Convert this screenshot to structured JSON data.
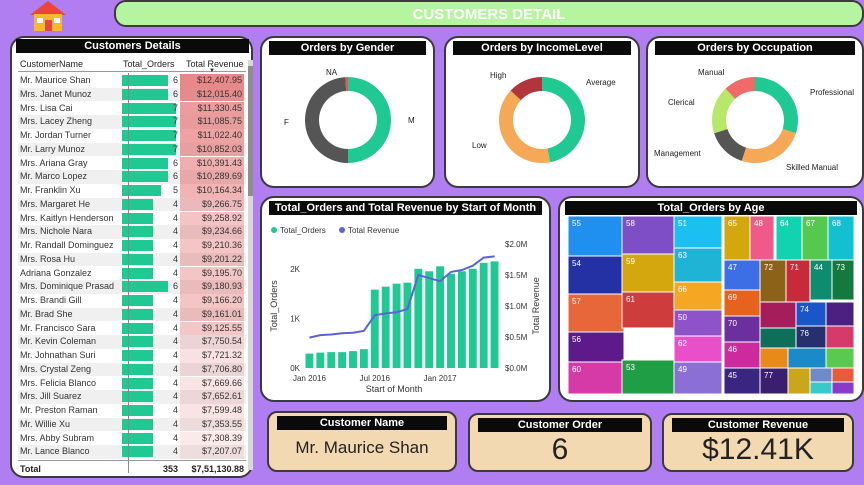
{
  "header": {
    "title": "CUSTOMERS DETAIL"
  },
  "icons": {
    "home": "home-icon"
  },
  "colors": {
    "accent_green": "#1fc991",
    "revenue_red": "#e05a5a",
    "background": "#b07ef0",
    "banner": "#b6f5a0",
    "kpi_bg": "#f3d9b1"
  },
  "table": {
    "title": "Customers Details",
    "columns": [
      "CustomerName",
      "Total_Orders",
      "Total Revenue"
    ],
    "rows": [
      {
        "name": "Mr. Maurice Shan",
        "orders": 6,
        "revenue": "$12,407.95"
      },
      {
        "name": "Mrs. Janet Munoz",
        "orders": 6,
        "revenue": "$12,015.40"
      },
      {
        "name": "Mrs. Lisa Cai",
        "orders": 7,
        "revenue": "$11,330.45"
      },
      {
        "name": "Mrs. Lacey Zheng",
        "orders": 7,
        "revenue": "$11,085.75"
      },
      {
        "name": "Mr. Jordan Turner",
        "orders": 7,
        "revenue": "$11,022.40"
      },
      {
        "name": "Mr. Larry Munoz",
        "orders": 7,
        "revenue": "$10,852.03"
      },
      {
        "name": "Mrs. Ariana Gray",
        "orders": 6,
        "revenue": "$10,391.43"
      },
      {
        "name": "Mr. Marco Lopez",
        "orders": 6,
        "revenue": "$10,289.69"
      },
      {
        "name": "Mr. Franklin Xu",
        "orders": 5,
        "revenue": "$10,164.34"
      },
      {
        "name": "Mrs. Margaret He",
        "orders": 4,
        "revenue": "$9,266.75"
      },
      {
        "name": "Mrs. Kaitlyn Henderson",
        "orders": 4,
        "revenue": "$9,258.92"
      },
      {
        "name": "Mrs. Nichole Nara",
        "orders": 4,
        "revenue": "$9,234.66"
      },
      {
        "name": "Mr. Randall Dominguez",
        "orders": 4,
        "revenue": "$9,210.36"
      },
      {
        "name": "Mrs. Rosa Hu",
        "orders": 4,
        "revenue": "$9,201.22"
      },
      {
        "name": "Adriana Gonzalez",
        "orders": 4,
        "revenue": "$9,195.70"
      },
      {
        "name": "Mrs. Dominique Prasad",
        "orders": 6,
        "revenue": "$9,180.93"
      },
      {
        "name": "Mrs. Brandi Gill",
        "orders": 4,
        "revenue": "$9,166.20"
      },
      {
        "name": "Mr. Brad She",
        "orders": 4,
        "revenue": "$9,161.01"
      },
      {
        "name": "Mr. Francisco Sara",
        "orders": 4,
        "revenue": "$9,125.55"
      },
      {
        "name": "Mr. Kevin Coleman",
        "orders": 4,
        "revenue": "$7,750.54"
      },
      {
        "name": "Mr. Johnathan Suri",
        "orders": 4,
        "revenue": "$7,721.32"
      },
      {
        "name": "Mrs. Crystal Zeng",
        "orders": 4,
        "revenue": "$7,706.80"
      },
      {
        "name": "Mrs. Felicia Blanco",
        "orders": 4,
        "revenue": "$7,669.66"
      },
      {
        "name": "Mrs. Jill Suarez",
        "orders": 4,
        "revenue": "$7,652.61"
      },
      {
        "name": "Mr. Preston Raman",
        "orders": 4,
        "revenue": "$7,599.48"
      },
      {
        "name": "Mr. Willie Xu",
        "orders": 4,
        "revenue": "$7,353.55"
      },
      {
        "name": "Mrs. Abby Subram",
        "orders": 4,
        "revenue": "$7,308.39"
      },
      {
        "name": "Mr. Lance Blanco",
        "orders": 4,
        "revenue": "$7,207.07"
      }
    ],
    "total": {
      "label": "Total",
      "orders": "353",
      "revenue": "$7,51,130.88"
    }
  },
  "chart_data": [
    {
      "type": "pie",
      "donut": true,
      "title": "Orders by Gender",
      "labels": [
        "M",
        "F",
        "NA"
      ],
      "values": [
        50,
        49,
        1
      ],
      "colors": [
        "#1fc991",
        "#555555",
        "#e05a5a"
      ]
    },
    {
      "type": "pie",
      "donut": true,
      "title": "Orders by IncomeLevel",
      "labels": [
        "Average",
        "Low",
        "High"
      ],
      "values": [
        47,
        40,
        13
      ],
      "colors": [
        "#1fc991",
        "#f5a855",
        "#b0353d"
      ]
    },
    {
      "type": "pie",
      "donut": true,
      "title": "Orders by Occupation",
      "labels": [
        "Professional",
        "Skilled Manual",
        "Management",
        "Clerical",
        "Manual"
      ],
      "values": [
        30,
        25,
        15,
        18,
        12
      ],
      "colors": [
        "#1fc991",
        "#f5a855",
        "#555555",
        "#b8e86a",
        "#f06a6a"
      ]
    },
    {
      "type": "bar+line",
      "title": "Total_Orders and Total Revenue by Start of Month",
      "xlabel": "Start of Month",
      "ylabel": "Total_Orders",
      "y2label": "Total Revenue",
      "x_ticks": [
        "Jan 2016",
        "Jul 2016",
        "Jan 2017"
      ],
      "y_ticks": [
        "0K",
        "1K",
        "2K"
      ],
      "y2_ticks": [
        "$0.0M",
        "$0.5M",
        "$1.0M",
        "$1.5M",
        "$2.0M"
      ],
      "ylim": [
        0,
        2500
      ],
      "y2lim": [
        0,
        2000000
      ],
      "legend": [
        "Total_Orders",
        "Total Revenue"
      ],
      "categories": [
        "2016-01",
        "2016-02",
        "2016-03",
        "2016-04",
        "2016-05",
        "2016-06",
        "2016-07",
        "2016-08",
        "2016-09",
        "2016-10",
        "2016-11",
        "2016-12",
        "2017-01",
        "2017-02",
        "2017-03",
        "2017-04",
        "2017-05",
        "2017-06"
      ],
      "series": [
        {
          "name": "Total_Orders",
          "values": [
            290,
            310,
            320,
            320,
            340,
            380,
            1580,
            1640,
            1700,
            1720,
            2000,
            1950,
            2050,
            1900,
            1950,
            2000,
            2120,
            2150
          ]
        },
        {
          "name": "Total Revenue",
          "values": [
            490000,
            530000,
            540000,
            560000,
            570000,
            600000,
            850000,
            880000,
            900000,
            950000,
            1500000,
            1450000,
            1400000,
            1550000,
            1580000,
            1650000,
            1780000,
            1800000
          ]
        }
      ]
    },
    {
      "type": "treemap",
      "title": "Total_Orders by Age",
      "labels": [
        "55",
        "58",
        "51",
        "65",
        "48",
        "64",
        "67",
        "68",
        "54",
        "59",
        "63",
        "47",
        "72",
        "71",
        "44",
        "73",
        "57",
        "61",
        "66",
        "69",
        "74",
        "50",
        "70",
        "56",
        "62",
        "76",
        "60",
        "53",
        "49",
        "46",
        "45",
        "77"
      ],
      "values": [
        90,
        85,
        60,
        40,
        38,
        36,
        34,
        30,
        88,
        80,
        55,
        36,
        30,
        30,
        28,
        28,
        86,
        78,
        50,
        34,
        26,
        48,
        32,
        84,
        46,
        22,
        82,
        60,
        44,
        30,
        30,
        20
      ]
    }
  ],
  "kpis": {
    "name": {
      "label": "Customer Name",
      "value": "Mr. Maurice Shan"
    },
    "orders": {
      "label": "Customer Order",
      "value": "6"
    },
    "revenue": {
      "label": "Customer Revenue",
      "value": "$12.41K"
    }
  }
}
